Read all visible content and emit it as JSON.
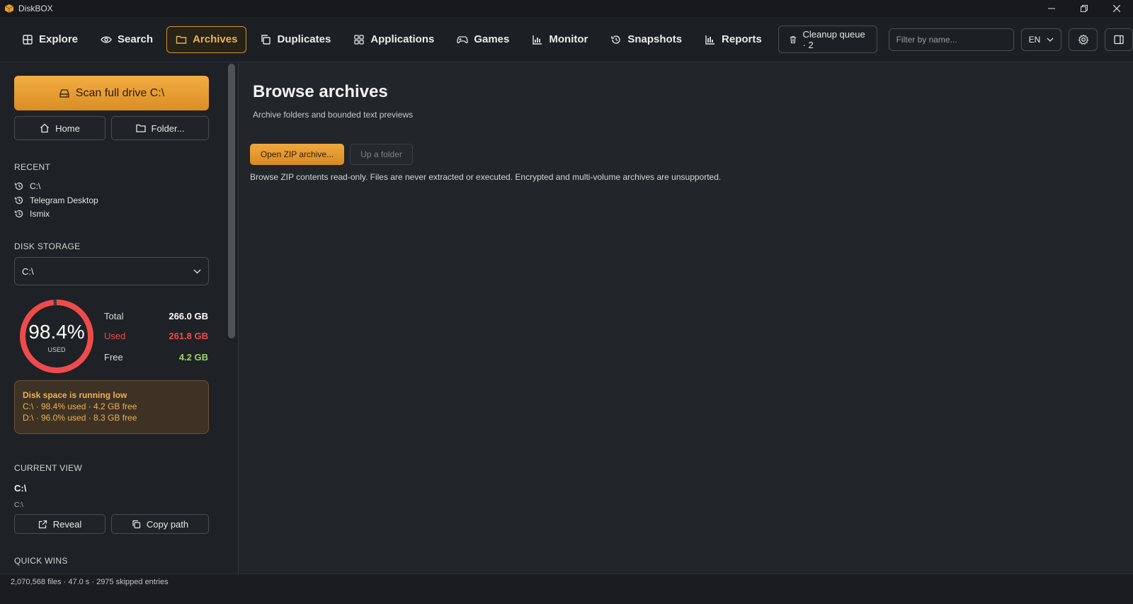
{
  "window": {
    "title": "DiskBOX",
    "logo_icon": "box-icon",
    "controls": [
      "minimize-icon",
      "restore-icon",
      "close-icon"
    ]
  },
  "nav": {
    "tabs": [
      {
        "label": "Explore",
        "icon": "grid-icon",
        "active": false
      },
      {
        "label": "Search",
        "icon": "eye-icon",
        "active": false
      },
      {
        "label": "Archives",
        "icon": "folder-icon",
        "active": true
      },
      {
        "label": "Duplicates",
        "icon": "copy-icon",
        "active": false
      },
      {
        "label": "Applications",
        "icon": "apps-icon",
        "active": false
      },
      {
        "label": "Games",
        "icon": "gamepad-icon",
        "active": false
      },
      {
        "label": "Monitor",
        "icon": "bar-chart-icon",
        "active": false
      },
      {
        "label": "Snapshots",
        "icon": "history-icon",
        "active": false
      },
      {
        "label": "Reports",
        "icon": "report-icon",
        "active": false
      }
    ],
    "cleanup_queue_label": "Cleanup queue · 2",
    "filter_placeholder": "Filter by name...",
    "language": "EN",
    "accent_color": "#d9902a"
  },
  "sidebar": {
    "scan_button": "Scan full drive  C:\\",
    "home_button": "Home",
    "folder_button": "Folder...",
    "recent_label": "RECENT",
    "recent_items": [
      "C:\\",
      "Telegram Desktop",
      "Ismix"
    ],
    "disk_storage_label": "DISK STORAGE",
    "disk_selected": "C:\\",
    "gauge": {
      "percent_text": "98.4%",
      "percent_value": 98.4,
      "caption": "USED",
      "color": "#ef4b4b"
    },
    "stats": {
      "total_label": "Total",
      "total_value": "266.0 GB",
      "used_label": "Used",
      "used_value": "261.8 GB",
      "free_label": "Free",
      "free_value": "4.2 GB",
      "used_color": "#ef4b4b",
      "free_color": "#9ed36a"
    },
    "alert": {
      "title": "Disk space is running low",
      "lines": [
        "C:\\ · 98.4% used · 4.2 GB free",
        "D:\\ · 96.0% used · 8.3 GB free"
      ]
    },
    "current_view_label": "CURRENT VIEW",
    "current_path": "C:\\",
    "current_path_sub": "C:\\",
    "reveal_button": "Reveal",
    "copy_path_button": "Copy path",
    "quick_wins_label": "QUICK WINS"
  },
  "main": {
    "title": "Browse archives",
    "subtitle": "Archive folders and bounded text previews",
    "open_zip_button": "Open ZIP archive...",
    "up_folder_button": "Up a folder",
    "info": "Browse ZIP contents read-only. Files are never extracted or executed. Encrypted and multi-volume archives are unsupported."
  },
  "status": {
    "text": "2,070,568 files · 47.0 s · 2975 skipped entries"
  }
}
